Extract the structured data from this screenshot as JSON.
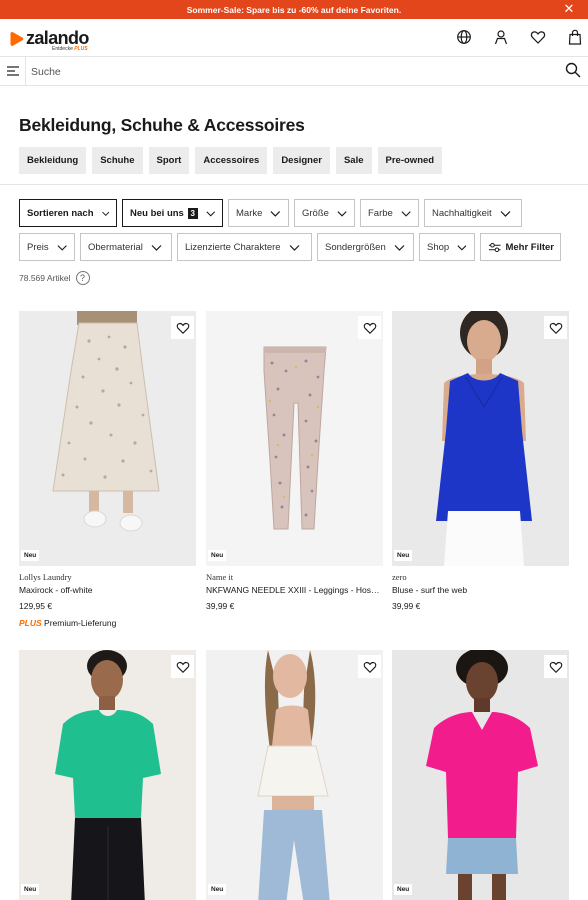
{
  "promo": {
    "text": "Sommer-Sale: Spare bis zu -60% auf deine Favoriten.",
    "close": "✕"
  },
  "header": {
    "logo": "zalando",
    "logo_sub_prefix": "Entdecke ",
    "logo_sub_plus": "PLUS",
    "brand_color": "#ff6900",
    "promo_color": "#e3461b",
    "icons": [
      "globe-icon",
      "user-icon",
      "heart-icon",
      "bag-icon"
    ]
  },
  "search": {
    "placeholder": "Suche"
  },
  "page": {
    "title": "Bekleidung, Schuhe & Accessoires",
    "categories": [
      "Bekleidung",
      "Schuhe",
      "Sport",
      "Accessoires",
      "Designer",
      "Sale",
      "Pre-owned"
    ]
  },
  "filters": {
    "row1": [
      {
        "label": "Sortieren nach"
      },
      {
        "label": "Neu bei uns",
        "badge": "3"
      },
      {
        "label": "Marke"
      },
      {
        "label": "Größe"
      },
      {
        "label": "Farbe"
      },
      {
        "label": "Nachhaltigkeit"
      }
    ],
    "row2": [
      {
        "label": "Preis"
      },
      {
        "label": "Obermaterial"
      },
      {
        "label": "Lizenzierte Charaktere"
      },
      {
        "label": "Sondergrößen"
      },
      {
        "label": "Shop"
      },
      {
        "label": "Mehr Filter"
      }
    ]
  },
  "results": {
    "count": "78.569 Artikel",
    "help": "?"
  },
  "products": [
    {
      "badge": "Neu",
      "brand": "Lollys Laundry",
      "name": "Maxirock - off-white",
      "price": "129,95 €",
      "plus": "PLUS",
      "delivery": " Premium-Lieferung"
    },
    {
      "badge": "Neu",
      "brand": "Name it",
      "name": "NKFWANG NEEDLE XXIII - Leggings - Hos…",
      "price": "39,99 €"
    },
    {
      "badge": "Neu",
      "brand": "zero",
      "name": "Bluse - surf the web",
      "price": "39,99 €"
    },
    {
      "badge": "Neu"
    },
    {
      "badge": "Neu"
    },
    {
      "badge": "Neu"
    }
  ]
}
